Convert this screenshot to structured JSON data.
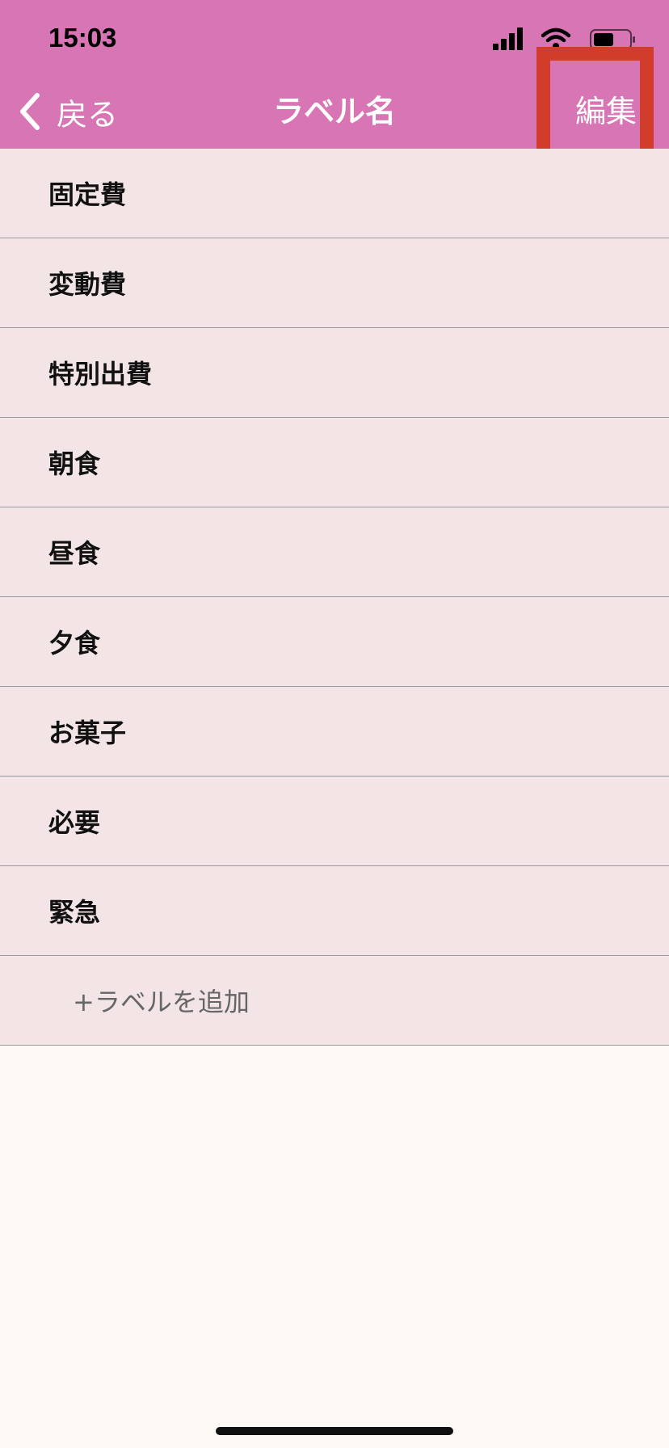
{
  "status_bar": {
    "time": "15:03",
    "icons": [
      "signal-icon",
      "wifi-icon",
      "battery-icon"
    ]
  },
  "nav": {
    "back_label": "戻る",
    "title": "ラベル名",
    "edit_label": "編集"
  },
  "labels": [
    "固定費",
    "変動費",
    "特別出費",
    "朝食",
    "昼食",
    "夕食",
    "お菓子",
    "必要",
    "緊急"
  ],
  "add_label": "+ラベルを追加",
  "colors": {
    "header": "#d775b5",
    "list_bg": "#f3e5e5",
    "page_bg": "#fcf8f3",
    "highlight": "#d23c2a"
  }
}
